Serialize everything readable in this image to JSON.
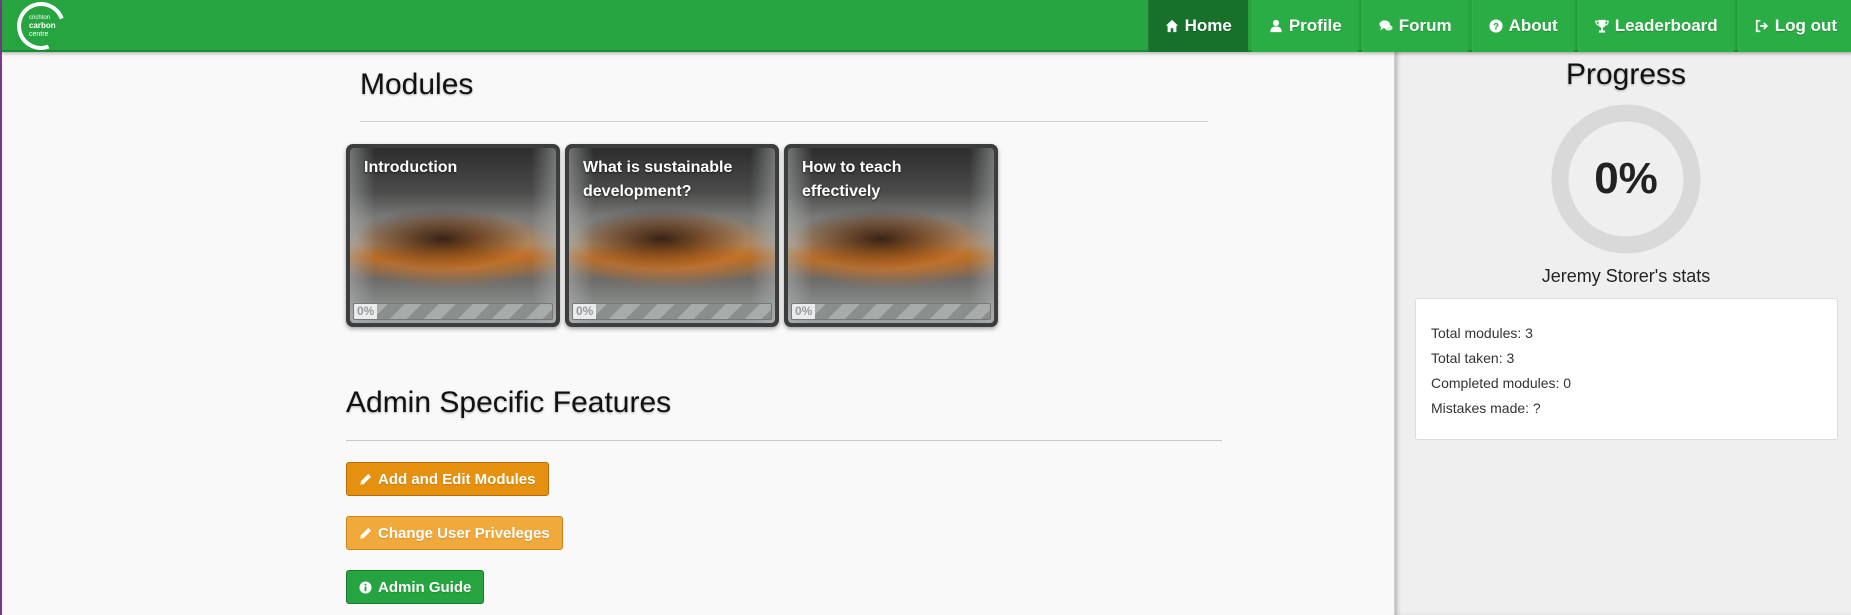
{
  "logo": {
    "line1": "crichton",
    "line2": "carbon",
    "line3": "centre"
  },
  "nav": {
    "items": [
      {
        "label": "Home",
        "icon": "home-icon",
        "active": true
      },
      {
        "label": "Profile",
        "icon": "user-icon",
        "active": false
      },
      {
        "label": "Forum",
        "icon": "comments-icon",
        "active": false
      },
      {
        "label": "About",
        "icon": "question-circle-icon",
        "active": false
      },
      {
        "label": "Leaderboard",
        "icon": "trophy-icon",
        "active": false
      },
      {
        "label": "Log out",
        "icon": "logout-icon",
        "active": false
      }
    ]
  },
  "modules": {
    "title": "Modules",
    "cards": [
      {
        "title": "Introduction",
        "progress_label": "0%",
        "progress": 0
      },
      {
        "title": "What is sustainable development?",
        "progress_label": "0%",
        "progress": 0
      },
      {
        "title": "How to teach effectively",
        "progress_label": "0%",
        "progress": 0
      }
    ]
  },
  "admin": {
    "title": "Admin Specific Features",
    "buttons": {
      "edit_modules": "Add and Edit Modules",
      "change_privileges": "Change User Priveleges",
      "admin_guide": "Admin Guide"
    }
  },
  "sidebar": {
    "title": "Progress",
    "percent_label": "0%",
    "percent": 0,
    "stats_title": "Jeremy Storer's stats",
    "stats": [
      "Total modules: 3",
      "Total taken: 3",
      "Completed modules: 0",
      "Mistakes made: ?"
    ]
  },
  "colors": {
    "brand_green": "#26a440",
    "active_nav": "#17712b",
    "edit_button": "#e6900f",
    "privileges_button": "#f2a93b"
  }
}
